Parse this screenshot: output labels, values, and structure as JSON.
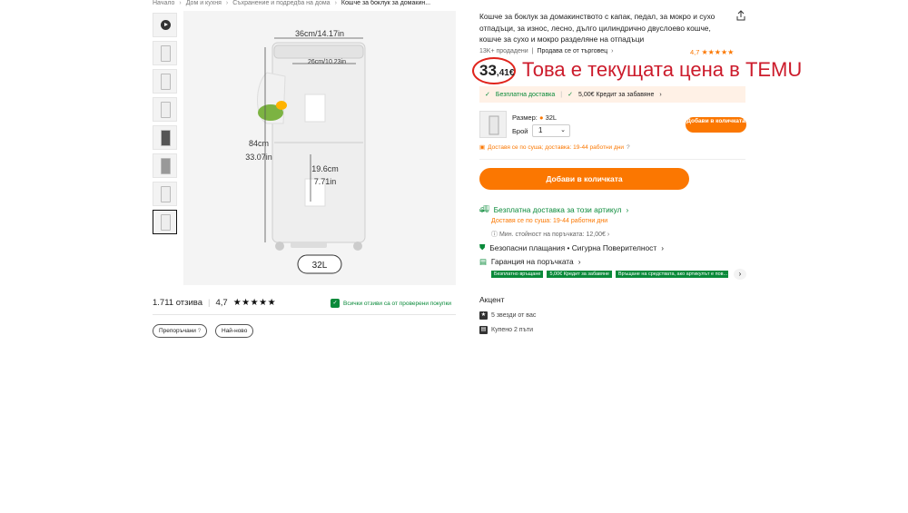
{
  "breadcrumb": [
    "Начало",
    "Дом и кухня",
    "Съхранение и подредба на дома",
    "Кошче за боклук за домакин..."
  ],
  "product": {
    "title": "Кошче за боклук за домакинството с капак, педал, за мокро и сухо отпадъци, за износ, лесно, дълго цилиндрично двуслоево кошче, кошче за сухо и мокро разделяне на отпадъци",
    "sold": "13K+ продадени",
    "seller": "Продава се от търговец",
    "rating": "4,7",
    "price_main": "33",
    "price_decimal": ",41€",
    "annotation": "Това е текущата цена в TEMU"
  },
  "image": {
    "width_label": "36cm/14.17in",
    "depth_label": "26cm/10.23in",
    "height_cm": "84cm",
    "height_in": "33.07in",
    "inner_cm": "19.6cm",
    "inner_in": "7.71in",
    "capacity": "32L"
  },
  "shipping_banner": {
    "free": "Безплатна доставка",
    "credit": "5,00€ Кредит за забавяне"
  },
  "options": {
    "size_label": "Размер:",
    "size_value": "32L",
    "qty_label": "Брой",
    "qty_value": "1",
    "add_small": "Добави в количката",
    "delivery_note": "Доставя се по суша; доставка: 19-44 работни дни"
  },
  "add_to_cart": "Добави в количката",
  "info": {
    "free_ship": "Безплатна доставка за този артикул",
    "delivery": "Доставя се по суша: 19-44 работни дни",
    "min_value": "Мин. стойност на поръчката: 12,00€",
    "secure": "Безопасни плащания • Сигурна Поверителност",
    "guarantee": "Гаранция на поръчката",
    "badges": [
      "Безплатно връщане",
      "5,00€ Кредит за забавяне",
      "Връщане на средствата, ако артикулът е пов..."
    ]
  },
  "accent": {
    "title": "Акцент",
    "stars": "5 звезди от вас",
    "bought": "Купено 2 пъти"
  },
  "reviews": {
    "count": "1.711 отзива",
    "rating": "4,7",
    "verified": "Всички отзиви са от проверени покупки",
    "filters": [
      "Препоръчани",
      "Най-ново"
    ]
  },
  "colors": {
    "accent": "#fb7701",
    "green": "#0a8a3a",
    "annotation": "#cc1b2b"
  }
}
